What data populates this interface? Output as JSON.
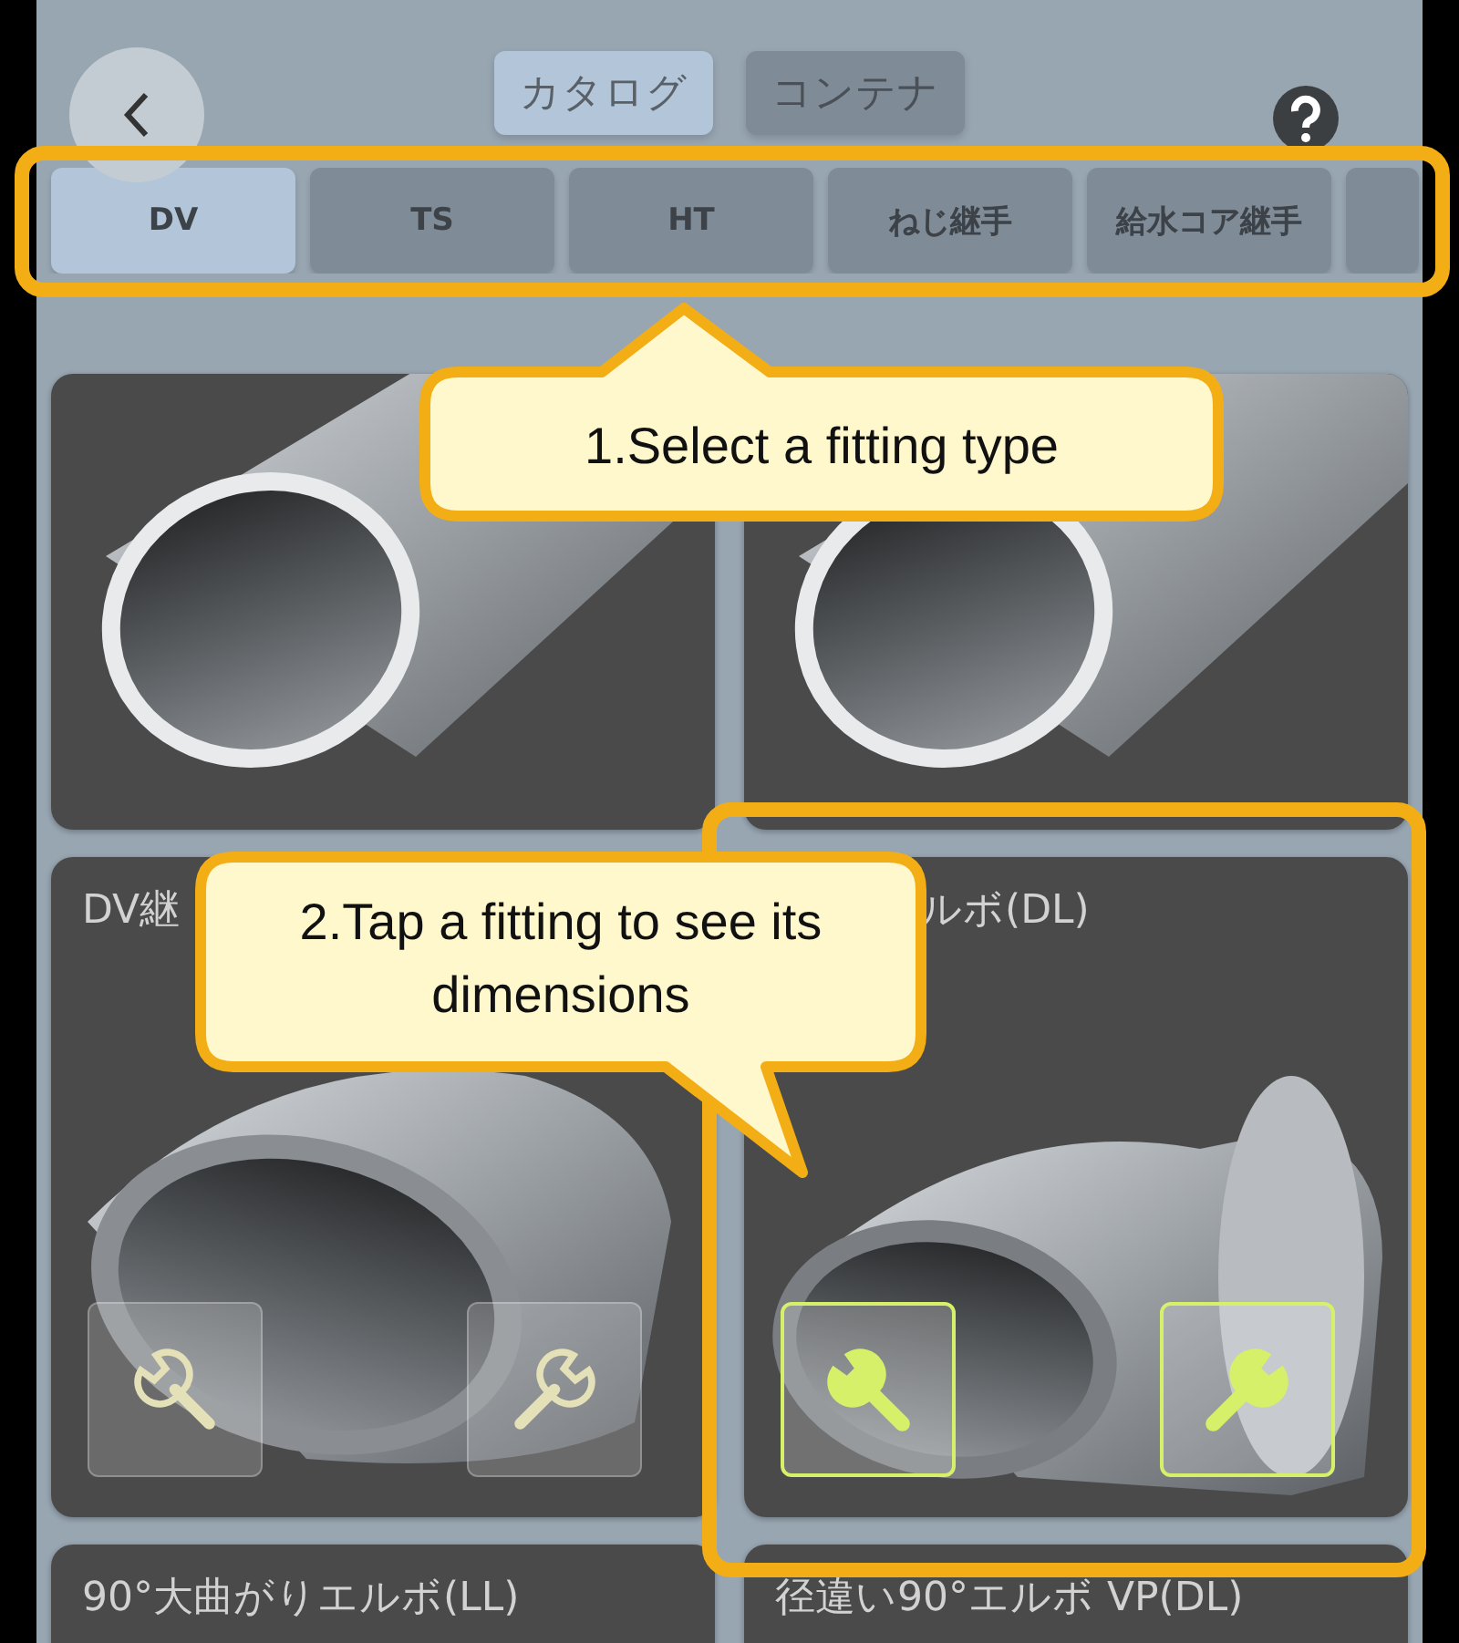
{
  "segments": [
    {
      "label": "カタログ",
      "selected": true
    },
    {
      "label": "コンテナ",
      "selected": false
    }
  ],
  "fitting_types": [
    {
      "label": "DV",
      "selected": true
    },
    {
      "label": "TS",
      "selected": false
    },
    {
      "label": "HT",
      "selected": false
    },
    {
      "label": "ねじ継手",
      "selected": false
    },
    {
      "label": "給水コア継手",
      "selected": false
    },
    {
      "selected": false
    }
  ],
  "cards": [
    {
      "kind": "pipe"
    },
    {
      "kind": "pipe"
    },
    {
      "kind": "elbow",
      "title": "DV継",
      "tools_highlighted": false
    },
    {
      "kind": "elbow-socket",
      "title": "ルボ(DL)",
      "title_covered": true,
      "tools_highlighted": true
    },
    {
      "kind": "cut",
      "title": "90°大曲がりエルボ(LL)"
    },
    {
      "kind": "cut",
      "title": "径違い90°エルボ VP(DL)"
    }
  ],
  "annotations": [
    {
      "kind": "frame"
    },
    {
      "kind": "callout",
      "text": "1.Select a fitting type"
    },
    {
      "kind": "frame"
    },
    {
      "kind": "callout",
      "text": "2.Tap a fitting to see its dimensions"
    }
  ]
}
